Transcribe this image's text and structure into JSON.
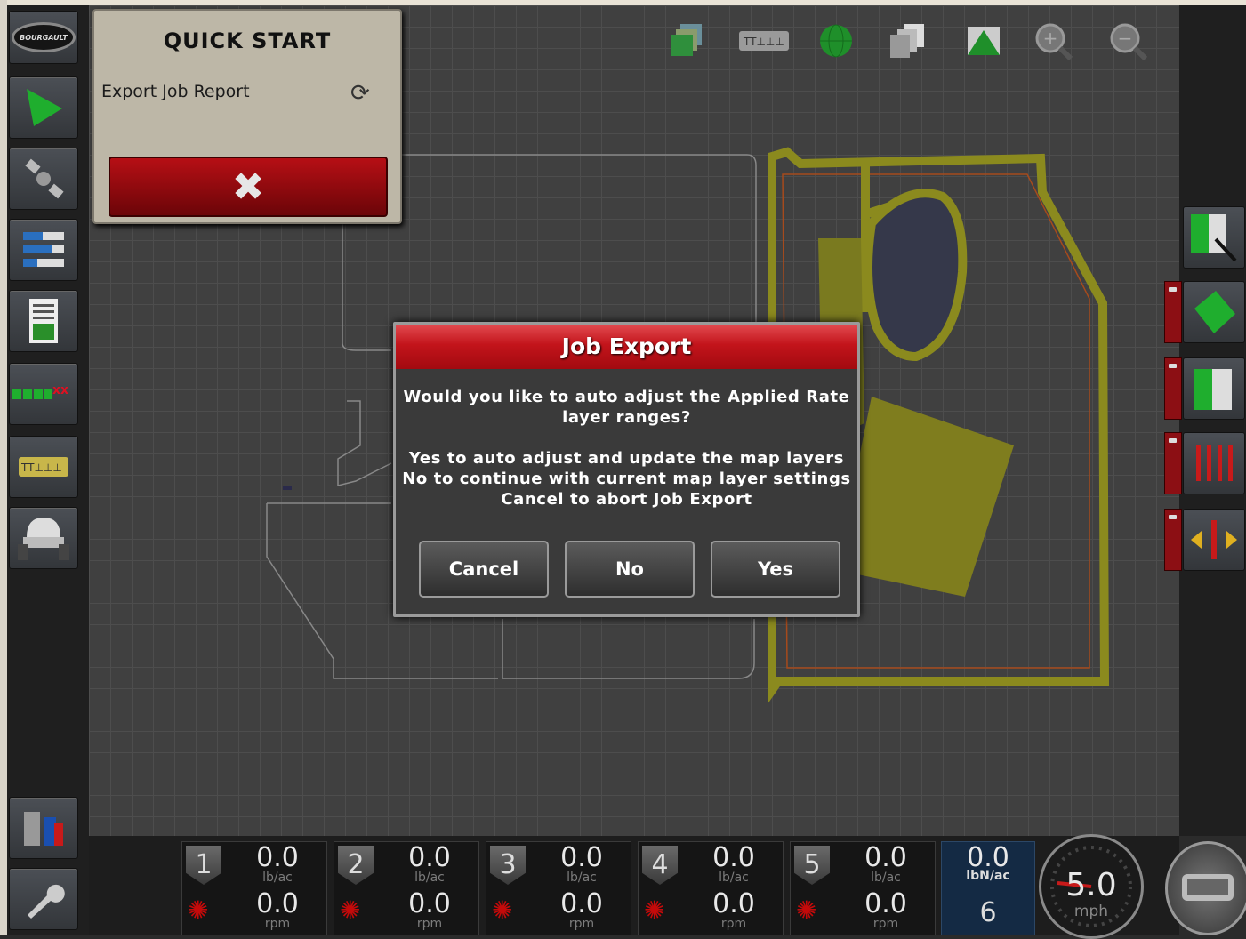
{
  "left_sidebar": {
    "logo_text": "BOURGAULT",
    "items": [
      {
        "icon": "guidance-arrow-icon"
      },
      {
        "icon": "satellite-icon"
      },
      {
        "icon": "layers-list-icon"
      },
      {
        "icon": "report-document-icon"
      },
      {
        "icon": "section-control-icon",
        "label": "xx"
      },
      {
        "icon": "implement-config-icon"
      },
      {
        "icon": "vehicle-icon"
      },
      {
        "icon": "data-transfer-icon"
      },
      {
        "icon": "wrench-settings-icon"
      }
    ]
  },
  "toolbar": {
    "icons": [
      "layer-stack-icon",
      "implement-sections-icon",
      "globe-view-icon",
      "pages-icon",
      "terrain-view-icon",
      "zoom-in-icon",
      "zoom-out-icon"
    ]
  },
  "quick_start": {
    "title": "QUICK START",
    "item_label": "Export Job Report",
    "close_symbol": "✖"
  },
  "dialog": {
    "title": "Job Export",
    "question_line1": "Would you like to auto adjust the Applied Rate",
    "question_line2": "layer ranges?",
    "info_line1": "Yes to auto adjust and update the map layers",
    "info_line2": "No to continue with current map layer settings",
    "info_line3": "Cancel to abort Job Export",
    "buttons": {
      "cancel": "Cancel",
      "no": "No",
      "yes": "Yes"
    }
  },
  "right_sidebar": {
    "icons": [
      "map-legend-icon",
      "field-boundary-icon",
      "headland-icon",
      "tramline-icon",
      "swath-shift-icon"
    ]
  },
  "sections": [
    {
      "num": "1",
      "rate": "0.0",
      "rate_unit": "lb/ac",
      "speed": "0.0",
      "speed_unit": "rpm"
    },
    {
      "num": "2",
      "rate": "0.0",
      "rate_unit": "lb/ac",
      "speed": "0.0",
      "speed_unit": "rpm"
    },
    {
      "num": "3",
      "rate": "0.0",
      "rate_unit": "lb/ac",
      "speed": "0.0",
      "speed_unit": "rpm"
    },
    {
      "num": "4",
      "rate": "0.0",
      "rate_unit": "lb/ac",
      "speed": "0.0",
      "speed_unit": "rpm"
    },
    {
      "num": "5",
      "rate": "0.0",
      "rate_unit": "lb/ac",
      "speed": "0.0",
      "speed_unit": "rpm"
    }
  ],
  "rate_summary": {
    "value": "0.0",
    "unit": "lbN/ac",
    "count": "6"
  },
  "speedometer": {
    "value": "5.0",
    "unit": "mph"
  },
  "colors": {
    "accent_red": "#c3141b",
    "coverage_yellow": "#8b8a1e",
    "map_bg": "#404040"
  }
}
